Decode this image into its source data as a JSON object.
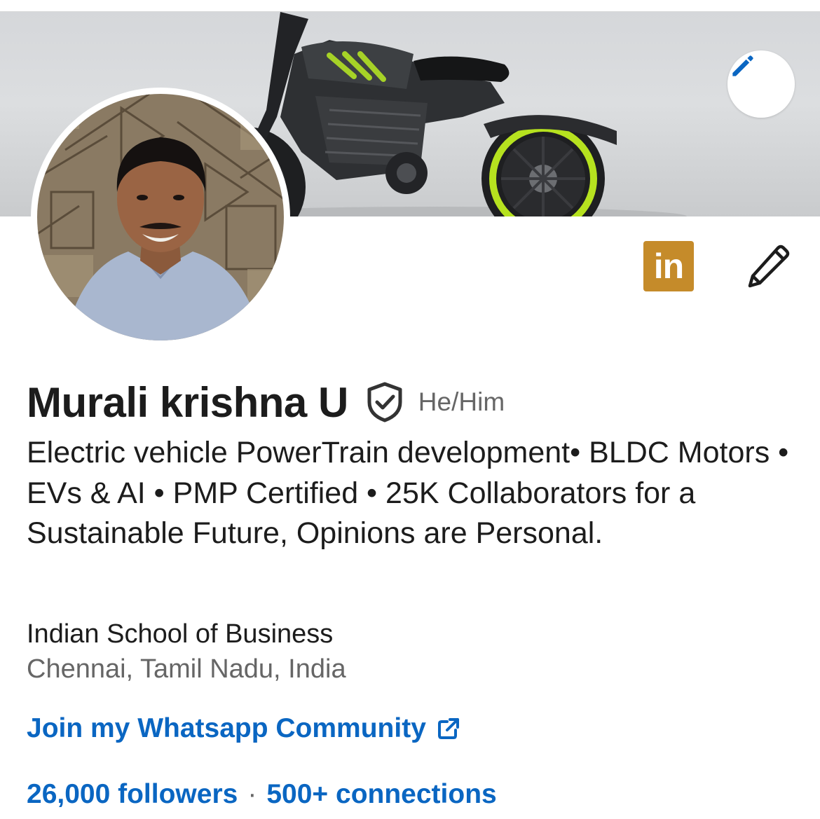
{
  "profile": {
    "name": "Murali krishna U",
    "pronouns": "He/Him",
    "headline": "Electric vehicle PowerTrain development• BLDC Motors • EVs & AI • PMP Certified • 25K Collaborators for a Sustainable Future, Opinions are Personal.",
    "school": "Indian School of Business",
    "location": "Chennai, Tamil Nadu, India",
    "custom_link": "Join my Whatsapp Community",
    "followers": "26,000 followers",
    "stats_separator": "·",
    "connections": "500+ connections"
  },
  "badges": {
    "linkedin_logo_text": "in"
  },
  "icons": {
    "cover_edit": "pencil-icon",
    "profile_edit": "pencil-outline-icon",
    "verified": "shield-check-icon",
    "external_link": "external-link-icon"
  },
  "colors": {
    "link_blue": "#0a66c2",
    "linkedin_badge": "#c58b2a",
    "text_primary": "#1c1c1c",
    "text_secondary": "#666666"
  }
}
